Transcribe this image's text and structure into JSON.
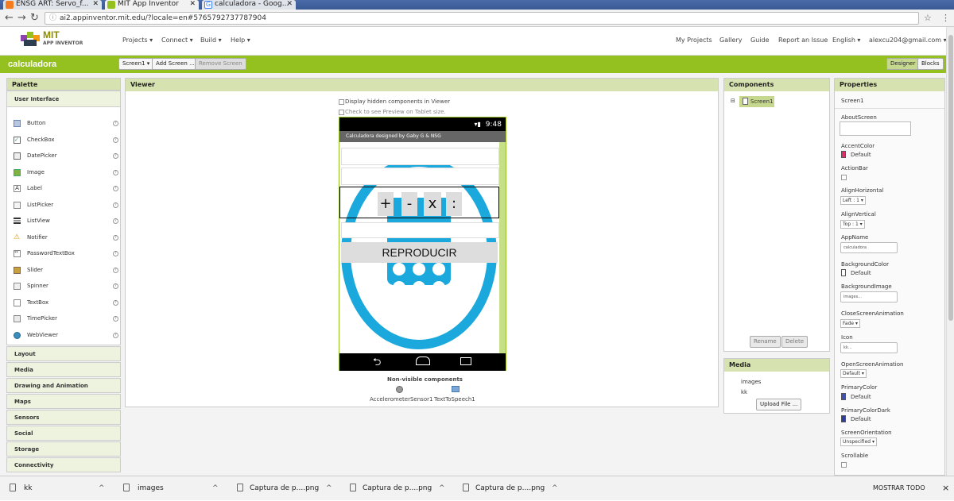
{
  "browser": {
    "tabs": [
      {
        "label": "ENSG ART: Servo_f...",
        "icon_color": "#f47b20"
      },
      {
        "label": "MIT App Inventor",
        "icon_color": "#94c11f"
      },
      {
        "label": "calculadora - Goog...",
        "icon_color": "#4285f4"
      }
    ],
    "url": "ai2.appinventor.mit.edu/?locale=en#5765792737787904",
    "star_icon": "star-icon"
  },
  "header": {
    "logo_title": "MIT",
    "logo_subtitle": "APP INVENTOR",
    "menus": [
      "Projects ▾",
      "Connect ▾",
      "Build ▾",
      "Help ▾"
    ],
    "right_links": [
      "My Projects",
      "Gallery",
      "Guide",
      "Report an Issue",
      "English ▾",
      "alexcu204@gmail.com ▾"
    ]
  },
  "toolbar": {
    "project_name": "calculadora",
    "screen_select": "Screen1 ▾",
    "add_screen": "Add Screen ...",
    "remove_screen": "Remove Screen",
    "designer": "Designer",
    "blocks": "Blocks"
  },
  "palette": {
    "title": "Palette",
    "section": "User Interface",
    "items": [
      "Button",
      "CheckBox",
      "DatePicker",
      "Image",
      "Label",
      "ListPicker",
      "ListView",
      "Notifier",
      "PasswordTextBox",
      "Slider",
      "Spinner",
      "TextBox",
      "TimePicker",
      "WebViewer"
    ],
    "help_glyph": "?",
    "categories": [
      "Layout",
      "Media",
      "Drawing and Animation",
      "Maps",
      "Sensors",
      "Social",
      "Storage",
      "Connectivity"
    ]
  },
  "viewer": {
    "title": "Viewer",
    "option_hidden": "Display hidden components in Viewer",
    "option_tablet": "Check to see Preview on Tablet size.",
    "phone": {
      "time": "9:48",
      "app_title": "Calculadora designed by Gaby G & NSG",
      "operators": [
        "+",
        "-",
        "x",
        ":"
      ],
      "play_button": "REPRODUCIR"
    },
    "nonvisible_title": "Non-visible components",
    "nonvisible_items": [
      "AccelerometerSensor1",
      "TextToSpeech1"
    ]
  },
  "components": {
    "title": "Components",
    "tree_toggle": "⊟",
    "root": "Screen1",
    "rename": "Rename",
    "delete": "Delete"
  },
  "media": {
    "title": "Media",
    "files": [
      "images",
      "kk"
    ],
    "upload": "Upload File ..."
  },
  "properties": {
    "title": "Properties",
    "component": "Screen1",
    "about_label": "AboutScreen",
    "accent_label": "AccentColor",
    "accent_value": "Default",
    "accent_color": "#e0306a",
    "actionbar_label": "ActionBar",
    "alignh_label": "AlignHorizontal",
    "alignh_value": "Left : 1 ▾",
    "alignv_label": "AlignVertical",
    "alignv_value": "Top : 1 ▾",
    "appname_label": "AppName",
    "appname_value": "calculadora",
    "bgcolor_label": "BackgroundColor",
    "bgcolor_value": "Default",
    "bgimage_label": "BackgroundImage",
    "bgimage_value": "images...",
    "closeanim_label": "CloseScreenAnimation",
    "closeanim_value": "Fade ▾",
    "icon_label": "Icon",
    "icon_value": "kk...",
    "openanim_label": "OpenScreenAnimation",
    "openanim_value": "Default ▾",
    "primary_label": "PrimaryColor",
    "primary_value": "Default",
    "primary_color": "#3f51b5",
    "primarydark_label": "PrimaryColorDark",
    "primarydark_value": "Default",
    "primarydark_color": "#303f9f",
    "orientation_label": "ScreenOrientation",
    "orientation_value": "Unspecified ▾",
    "scrollable_label": "Scrollable"
  },
  "downloads": {
    "items": [
      "kk",
      "images",
      "Captura de p....png",
      "Captura de p....png",
      "Captura de p....png"
    ],
    "show_all": "MOSTRAR TODO",
    "close": "×"
  },
  "colors": {
    "brand_green": "#94c11f",
    "panel_header": "#d6e3b0",
    "phone_blue": "#1ba9dd"
  }
}
